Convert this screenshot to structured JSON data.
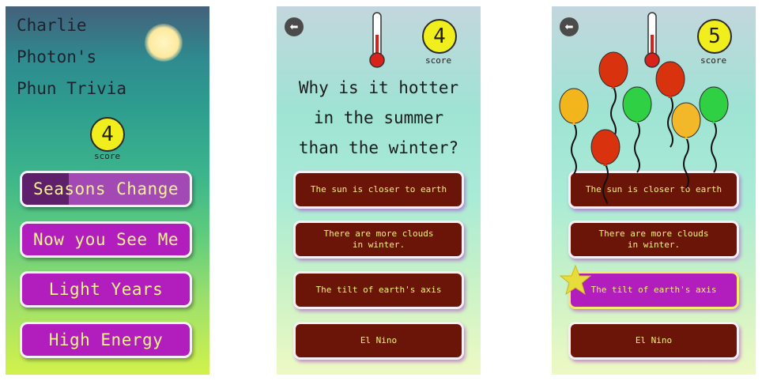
{
  "screen1": {
    "title_lines": [
      "Charlie",
      "Photon's",
      "Phun Trivia"
    ],
    "score": {
      "value": "4",
      "label": "score"
    },
    "categories": [
      {
        "label": "Seasons Change",
        "selected": true,
        "progress": 0.28
      },
      {
        "label": "Now you See Me"
      },
      {
        "label": "Light Years"
      },
      {
        "label": "High Energy"
      }
    ],
    "icons": [
      "sun-icon"
    ]
  },
  "screen2": {
    "score": {
      "value": "4",
      "label": "score"
    },
    "question_lines": [
      "Why is it hotter",
      "in the summer",
      "than the winter?"
    ],
    "answers": [
      {
        "label": "The sun is closer to earth"
      },
      {
        "label": "There are more clouds\nin winter."
      },
      {
        "label": "The tilt of earth's axis"
      },
      {
        "label": "El Nino"
      }
    ],
    "icons": [
      "back-arrow-icon",
      "thermometer-icon"
    ]
  },
  "screen3": {
    "score": {
      "value": "5",
      "label": "score"
    },
    "answers": [
      {
        "label": "The sun is closer to earth"
      },
      {
        "label": "There are more clouds\nin winter."
      },
      {
        "label": "The tilt of earth's axis",
        "correct": true
      },
      {
        "label": "El Nino"
      }
    ],
    "icons": [
      "back-arrow-icon",
      "thermometer-icon",
      "star-icon",
      "balloon-icon"
    ],
    "balloon_colors": [
      "#f2b51c",
      "#d8330e",
      "#2fd043",
      "#d8330e",
      "#f3b82a",
      "#2fd043",
      "#d8330e"
    ]
  },
  "colors": {
    "category_button": "#b11ebd",
    "answer_button": "#6a1507",
    "button_text": "#f2f27a",
    "score_badge": "#f0ee1c"
  }
}
